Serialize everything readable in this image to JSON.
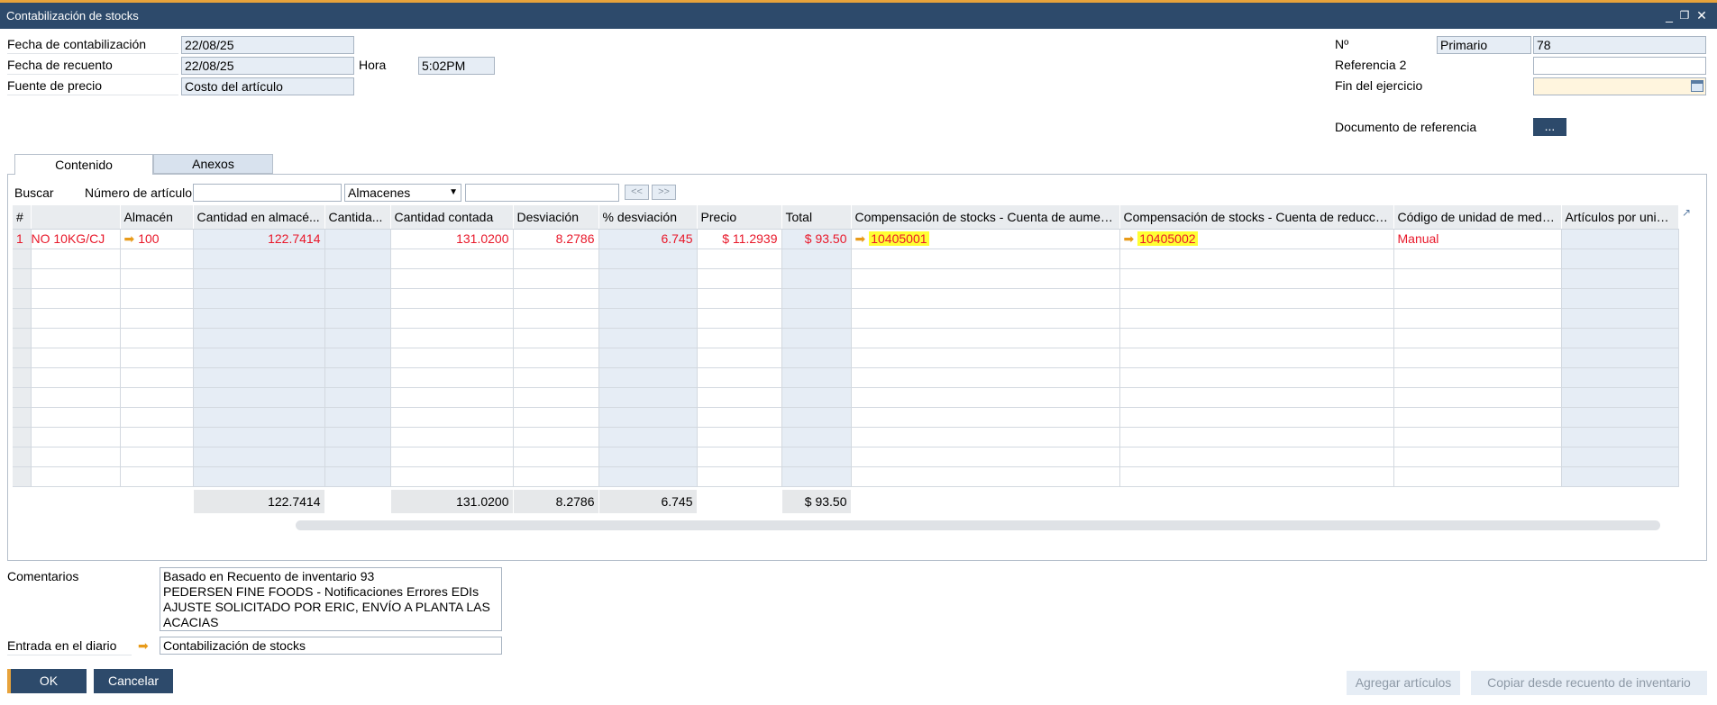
{
  "window": {
    "title": "Contabilización de stocks",
    "minimize": "_",
    "restore": "❐",
    "close": "✕"
  },
  "header": {
    "posting_date_label": "Fecha de contabilización",
    "posting_date": "22/08/25",
    "count_date_label": "Fecha de recuento",
    "count_date": "22/08/25",
    "time_label": "Hora",
    "time": "5:02PM",
    "price_source_label": "Fuente de precio",
    "price_source": "Costo del artículo",
    "number_label": "Nº",
    "series": "Primario",
    "number": "78",
    "ref2_label": "Referencia 2",
    "ref2": "",
    "fiscal_end_label": "Fin del ejercicio",
    "fiscal_end": "",
    "ref_doc_label": "Documento de referencia",
    "ref_doc_button": "..."
  },
  "tabs": [
    {
      "label": "Contenido"
    },
    {
      "label": "Anexos"
    }
  ],
  "search": {
    "label": "Buscar",
    "item_label": "Número de artículo",
    "item_value": "",
    "warehouse_select": "Almacenes",
    "warehouse_value": "",
    "prev": "<<",
    "next": ">>"
  },
  "grid": {
    "columns": [
      "#",
      "",
      "Almacén",
      "Cantidad en almacé...",
      "Cantida...",
      "Cantidad contada",
      "Desviación",
      "% desviación",
      "Precio",
      "Total",
      "Compensación de stocks - Cuenta de aumento",
      "Compensación de stocks - Cuenta de reducción",
      "Código de unidad de medida",
      "Artículos por unidad"
    ],
    "row1": {
      "index": "1",
      "item": "NO 10KG/CJ",
      "warehouse": "100",
      "in_stock": "122.7414",
      "counted": "131.0200",
      "deviation": "8.2786",
      "pct": "6.745",
      "price": "$ 11.2939",
      "total": "$ 93.50",
      "inc_account": "10405001",
      "dec_account": "10405002",
      "uom": "Manual"
    },
    "totals": {
      "in_stock": "122.7414",
      "counted": "131.0200",
      "deviation": "8.2786",
      "pct": "6.745",
      "total": "$ 93.50"
    }
  },
  "footer": {
    "comments_label": "Comentarios",
    "comments": [
      "Basado en Recuento de inventario 93",
      "PEDERSEN FINE FOODS - Notificaciones Errores EDIs",
      "AJUSTE SOLICITADO POR ERIC, ENVÍO A PLANTA LAS",
      "ACACIAS"
    ],
    "journal_label": "Entrada en el diario",
    "journal_value": "Contabilización de stocks",
    "ok": "OK",
    "cancel": "Cancelar",
    "add_items": "Agregar artículos",
    "copy_from_count": "Copiar desde recuento de inventario"
  },
  "colors": {
    "titlebar": "#2d4a6b",
    "accent": "#e8a33b",
    "value_red": "#e8182a",
    "highlight": "#ffff33"
  }
}
